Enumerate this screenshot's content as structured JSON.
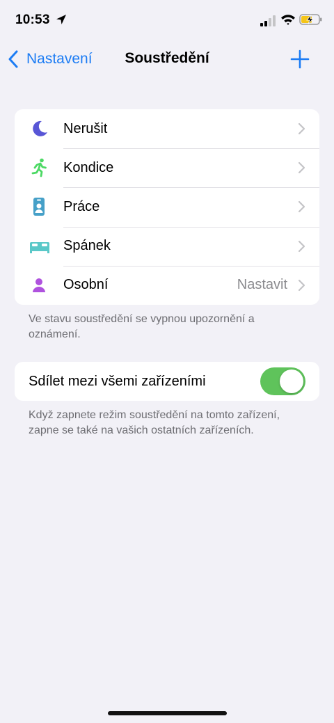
{
  "status_bar": {
    "time": "10:53",
    "icons": [
      "location-arrow-icon",
      "cellular-signal-icon",
      "wifi-icon",
      "battery-charging-icon"
    ]
  },
  "nav": {
    "back_label": "Nastavení",
    "title": "Soustředění",
    "add_icon": "plus-icon"
  },
  "focus_modes": [
    {
      "label": "Nerušit",
      "icon": "moon-icon",
      "color": "#5856d6",
      "value": ""
    },
    {
      "label": "Kondice",
      "icon": "running-figure-icon",
      "color": "#4cd964",
      "value": ""
    },
    {
      "label": "Práce",
      "icon": "id-badge-icon",
      "color": "#46a0c8",
      "value": ""
    },
    {
      "label": "Spánek",
      "icon": "bed-icon",
      "color": "#5ac8c8",
      "value": ""
    },
    {
      "label": "Osobní",
      "icon": "person-icon",
      "color": "#af52de",
      "value": "Nastavit"
    }
  ],
  "focus_footnote": "Ve stavu soustředění se vypnou upozornění a oznámení.",
  "share": {
    "label": "Sdílet mezi všemi zařízeními",
    "enabled": true,
    "footnote": "Když zapnete režim soustředění na tomto zařízení, zapne se také na vašich ostatních zařízeních."
  },
  "colors": {
    "accent": "#1c7cf4",
    "toggle_on": "#5fc35b",
    "background": "#f2f1f7"
  }
}
